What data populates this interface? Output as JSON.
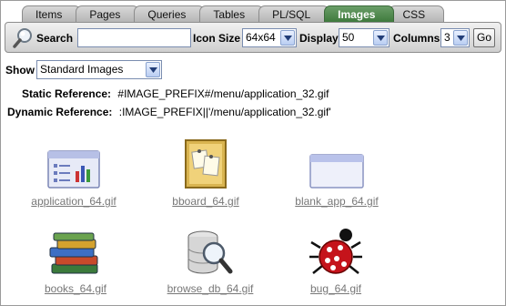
{
  "tabs": [
    "Items",
    "Pages",
    "Queries",
    "Tables",
    "PL/SQL",
    "Images",
    "CSS"
  ],
  "active_tab": "Images",
  "toolbar": {
    "search_label": "Search",
    "search_value": "",
    "icon_size_label": "Icon Size",
    "icon_size_value": "64x64",
    "display_label": "Display",
    "display_value": "50",
    "columns_label": "Columns",
    "columns_value": "3",
    "go_label": "Go"
  },
  "show": {
    "label": "Show",
    "value": "Standard Images"
  },
  "references": {
    "static_label": "Static Reference:",
    "static_value": "#IMAGE_PREFIX#/menu/application_32.gif",
    "dynamic_label": "Dynamic Reference:",
    "dynamic_value": ":IMAGE_PREFIX||'/menu/application_32.gif'"
  },
  "images": [
    {
      "file": "application_64.gif",
      "icon": "application-icon"
    },
    {
      "file": "bboard_64.gif",
      "icon": "bulletin-board-icon"
    },
    {
      "file": "blank_app_64.gif",
      "icon": "blank-app-icon"
    },
    {
      "file": "books_64.gif",
      "icon": "books-icon"
    },
    {
      "file": "browse_db_64.gif",
      "icon": "browse-db-icon"
    },
    {
      "file": "bug_64.gif",
      "icon": "bug-icon"
    }
  ],
  "colors": {
    "active_tab": "#4f8a4d",
    "tab": "#c4c4c4",
    "toolbar": "#dcdcdc",
    "link": "#777777"
  }
}
